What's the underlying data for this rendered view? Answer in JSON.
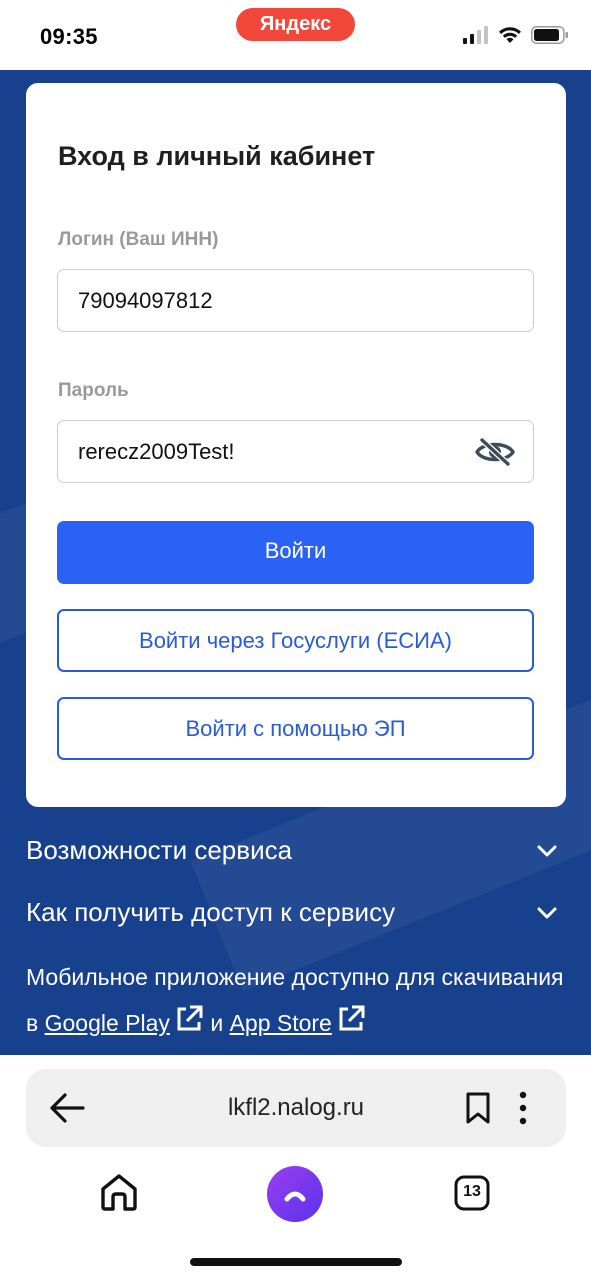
{
  "status_bar": {
    "time": "09:35",
    "yandex_label": "Яндекс"
  },
  "login": {
    "title": "Вход в личный кабинет",
    "login_label": "Логин (Ваш ИНН)",
    "login_value": "79094097812",
    "password_label": "Пароль",
    "password_value": "rerecz2009Test!",
    "submit_label": "Войти",
    "gosuslugi_label": "Войти через Госуслуги (ЕСИА)",
    "ep_label": "Войти с помощью ЭП"
  },
  "accordion": {
    "items": [
      {
        "label": "Возможности сервиса"
      },
      {
        "label": "Как получить доступ к сервису"
      }
    ]
  },
  "promo": {
    "text_before": "Мобильное приложение доступно для скачивания в",
    "google_play": "Google Play",
    "conjunction": "и",
    "app_store": "App Store"
  },
  "browser": {
    "url": "lkfl2.nalog.ru",
    "tabs_count": "13"
  },
  "colors": {
    "page_bg": "#18418d",
    "primary": "#2a62f4",
    "outline": "#2a5bd7",
    "yandex": "#f2483b",
    "alice": "#7b3cf0"
  }
}
